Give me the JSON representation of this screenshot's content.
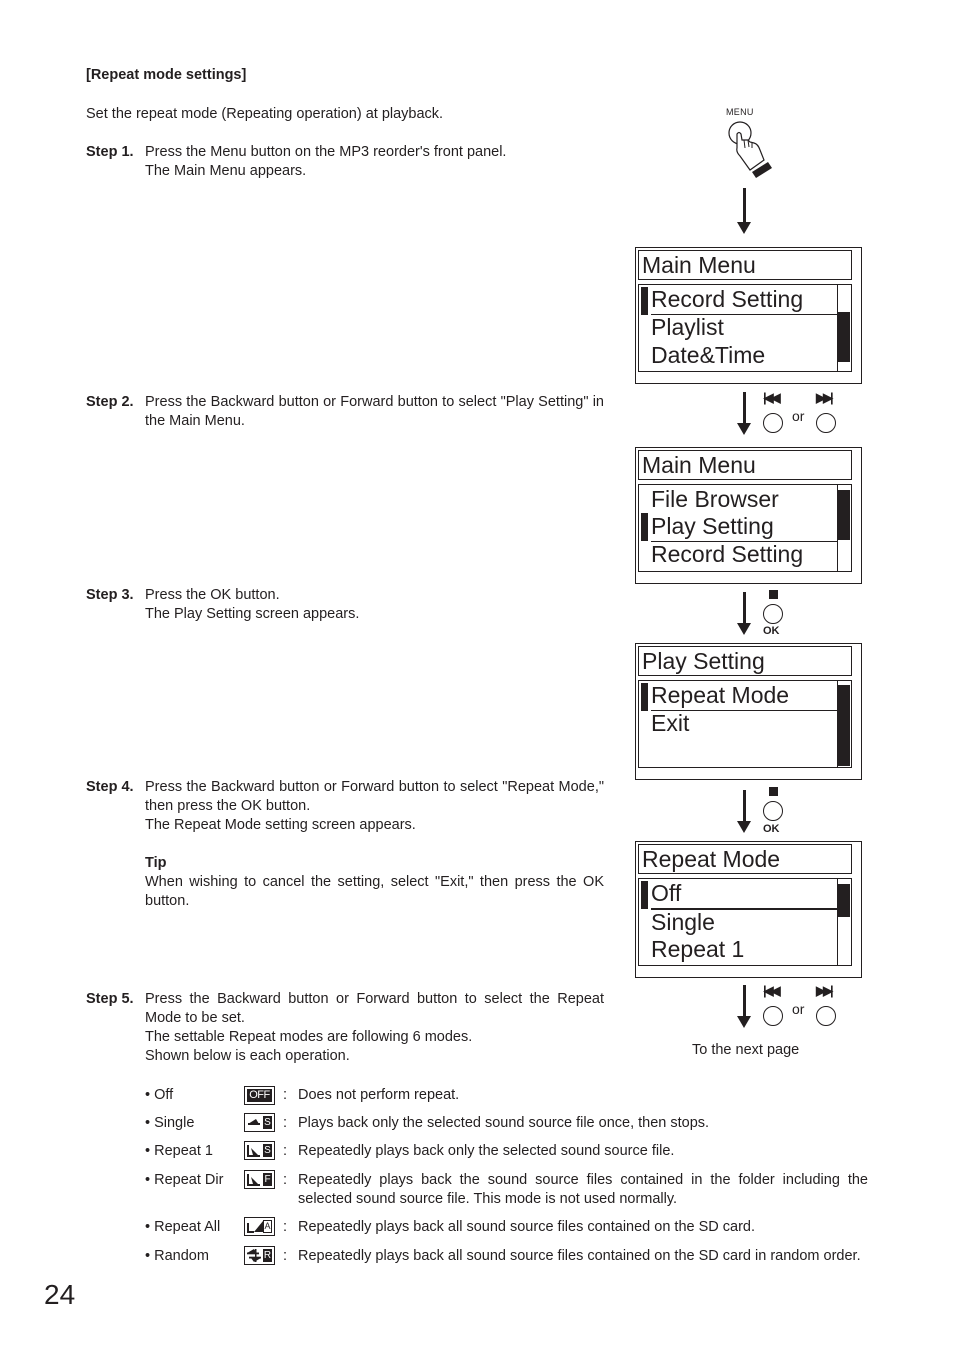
{
  "section_title": "[Repeat mode settings]",
  "intro": "Set the repeat mode (Repeating operation) at playback.",
  "steps": [
    {
      "label": "Step 1.",
      "lines": [
        "Press the Menu button on the MP3 reorder's front panel.",
        "The Main Menu appears."
      ]
    },
    {
      "label": "Step 2.",
      "lines": [
        "Press the Backward button or Forward button to select \"Play Setting\" in the Main Menu."
      ]
    },
    {
      "label": "Step 3.",
      "lines": [
        "Press the OK button.",
        "The Play Setting screen appears."
      ]
    },
    {
      "label": "Step 4.",
      "lines": [
        "Press the Backward button or Forward button to select \"Repeat Mode,\" then press the OK button.",
        "The Repeat Mode setting screen appears."
      ],
      "tip_title": "Tip",
      "tip_text": "When wishing to cancel the setting, select \"Exit,\" then press the OK button."
    },
    {
      "label": "Step 5.",
      "lines": [
        "Press the Backward button or Forward button to select the Repeat Mode to be set.",
        "The settable Repeat modes are following 6 modes.",
        "Shown below is each operation."
      ]
    }
  ],
  "diagram": {
    "menu_button_label": "MENU",
    "or_label": "or",
    "ok_label": "OK",
    "next_page_label": "To the next page",
    "screens": [
      {
        "title": "Main Menu",
        "items": [
          "Record Setting",
          "Playlist",
          "Date&Time"
        ],
        "selected_index": 0
      },
      {
        "title": "Main Menu",
        "items": [
          "File Browser",
          "Play Setting",
          "Record Setting"
        ],
        "selected_index": 1
      },
      {
        "title": "Play Setting",
        "items": [
          "Repeat Mode",
          "Exit",
          ""
        ],
        "selected_index": 0
      },
      {
        "title": "Repeat Mode",
        "items": [
          "Off",
          "Single",
          "Repeat 1"
        ],
        "selected_index": 0
      }
    ]
  },
  "modes": [
    {
      "name": "• Off",
      "icon": "off-icon",
      "icon_text": "OFF",
      "desc": "Does not perform repeat."
    },
    {
      "name": "• Single",
      "icon": "single-icon",
      "icon_text": "S",
      "desc": "Plays back only the selected sound source file once, then stops."
    },
    {
      "name": "• Repeat 1",
      "icon": "repeat-1-icon",
      "icon_text": "S",
      "desc": "Repeatedly plays back only the selected sound source file."
    },
    {
      "name": "• Repeat Dir",
      "icon": "repeat-dir-icon",
      "icon_text": "F",
      "desc": "Repeatedly plays back the sound source files contained in the folder including the selected sound source file. This mode is not used normally."
    },
    {
      "name": "• Repeat All",
      "icon": "repeat-all-icon",
      "icon_text": "A",
      "desc": "Repeatedly plays back all sound source files contained on the SD card."
    },
    {
      "name": "• Random",
      "icon": "random-icon",
      "icon_text": "R",
      "desc": "Repeatedly plays back all sound source files contained on the SD card in random order."
    }
  ],
  "colon": ":",
  "page_number": "24"
}
